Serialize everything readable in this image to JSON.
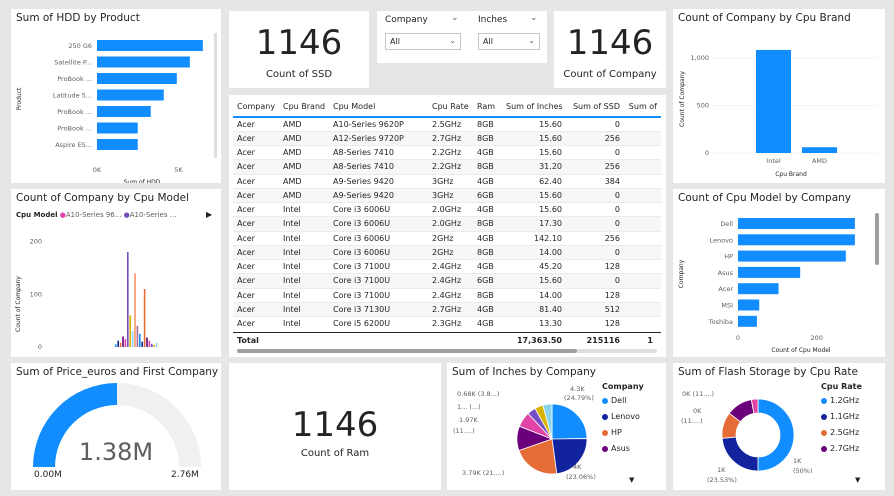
{
  "colors": {
    "accent": "#118dff",
    "dark": "#12239e",
    "orange": "#e66c37",
    "purple": "#6b007b",
    "pink": "#e044a7",
    "violet": "#744ec2",
    "yellow": "#d9b300",
    "track": "#f0f0f0"
  },
  "hdd_chart": {
    "title": "Sum of HDD by Product",
    "ylabel": "Product",
    "xlabel": "Sum of HDD",
    "ticks": [
      "0K",
      "5K"
    ],
    "chart_data": {
      "type": "bar",
      "categories": [
        "250 G6",
        "Satellite P...",
        "ProBook ...",
        "Latitude 5...",
        "ProBook ...",
        "ProBook ...",
        "Aspire ES..."
      ],
      "values": [
        6500,
        5700,
        4900,
        4100,
        3300,
        2500,
        2500
      ],
      "xlim": [
        0,
        7000
      ]
    }
  },
  "kpi_ssd": {
    "value": "1146",
    "label": "Count of SSD"
  },
  "slicer_company": {
    "title": "Company",
    "value": "All"
  },
  "slicer_inches": {
    "title": "Inches",
    "value": "All"
  },
  "kpi_company": {
    "value": "1146",
    "label": "Count of Company"
  },
  "cpu_brand_chart": {
    "title": "Count of Company by Cpu Brand",
    "ylabel": "Count of Company",
    "xlabel": "Cpu Brand",
    "yticks": [
      "1,000",
      "500",
      "0"
    ],
    "chart_data": {
      "type": "bar",
      "categories": [
        "Intel",
        "AMD"
      ],
      "values": [
        1085,
        61
      ],
      "ylim": [
        0,
        1200
      ]
    }
  },
  "table": {
    "columns": [
      "Company",
      "Cpu Brand",
      "Cpu Model",
      "Cpu Rate",
      "Ram",
      "Sum of Inches",
      "Sum of SSD",
      "Sum of"
    ],
    "rows": [
      [
        "Acer",
        "AMD",
        "A10-Series 9620P",
        "2.5GHz",
        "8GB",
        "15.60",
        "0",
        ""
      ],
      [
        "Acer",
        "AMD",
        "A12-Series 9720P",
        "2.7GHz",
        "8GB",
        "15.60",
        "256",
        ""
      ],
      [
        "Acer",
        "AMD",
        "A8-Series 7410",
        "2.2GHz",
        "4GB",
        "15.60",
        "0",
        ""
      ],
      [
        "Acer",
        "AMD",
        "A8-Series 7410",
        "2.2GHz",
        "8GB",
        "31.20",
        "256",
        ""
      ],
      [
        "Acer",
        "AMD",
        "A9-Series 9420",
        "3GHz",
        "4GB",
        "62.40",
        "384",
        ""
      ],
      [
        "Acer",
        "AMD",
        "A9-Series 9420",
        "3GHz",
        "6GB",
        "15.60",
        "0",
        ""
      ],
      [
        "Acer",
        "Intel",
        "Core i3 6006U",
        "2.0GHz",
        "4GB",
        "15.60",
        "0",
        ""
      ],
      [
        "Acer",
        "Intel",
        "Core i3 6006U",
        "2.0GHz",
        "8GB",
        "17.30",
        "0",
        ""
      ],
      [
        "Acer",
        "Intel",
        "Core i3 6006U",
        "2GHz",
        "4GB",
        "142.10",
        "256",
        ""
      ],
      [
        "Acer",
        "Intel",
        "Core i3 6006U",
        "2GHz",
        "8GB",
        "14.00",
        "0",
        ""
      ],
      [
        "Acer",
        "Intel",
        "Core i3 7100U",
        "2.4GHz",
        "4GB",
        "45.20",
        "128",
        ""
      ],
      [
        "Acer",
        "Intel",
        "Core i3 7100U",
        "2.4GHz",
        "6GB",
        "15.60",
        "0",
        ""
      ],
      [
        "Acer",
        "Intel",
        "Core i3 7100U",
        "2.4GHz",
        "8GB",
        "14.00",
        "128",
        ""
      ],
      [
        "Acer",
        "Intel",
        "Core i3 7130U",
        "2.7GHz",
        "4GB",
        "81.40",
        "512",
        ""
      ],
      [
        "Acer",
        "Intel",
        "Core i5 6200U",
        "2.3GHz",
        "4GB",
        "13.30",
        "128",
        ""
      ]
    ],
    "total": {
      "label": "Total",
      "inches": "17,363.50",
      "ssd": "215116",
      "more": "1"
    }
  },
  "cpu_model_chart": {
    "title": "Count of Company by Cpu Model",
    "legend_label": "Cpu Model",
    "legend_items": [
      "A10-Series 96...",
      "A10-Series ..."
    ],
    "ylabel": "Count of Company",
    "yticks": [
      "200",
      "100",
      "0"
    ],
    "chart_data": {
      "type": "bar",
      "note": "clustered bars by Cpu Model",
      "values": [
        5,
        12,
        8,
        20,
        15,
        180,
        60,
        30,
        140,
        40,
        25,
        10,
        110,
        18,
        12,
        6,
        4,
        8
      ],
      "ylim": [
        0,
        220
      ]
    }
  },
  "cpu_model_company_chart": {
    "title": "Count of Cpu Model by Company",
    "ylabel": "Company",
    "xlabel": "Count of Cpu Model",
    "ticks": [
      "0",
      "200"
    ],
    "chart_data": {
      "type": "bar",
      "categories": [
        "Dell",
        "Lenovo",
        "HP",
        "Asus",
        "Acer",
        "MSI",
        "Toshiba"
      ],
      "values": [
        297,
        297,
        274,
        158,
        103,
        54,
        48
      ],
      "xlim": [
        0,
        310
      ]
    }
  },
  "gauge": {
    "title": "Sum of Price_euros and First Company",
    "value": "1.38M",
    "min": "0.00M",
    "max": "2.76M",
    "fraction": 0.5
  },
  "kpi_ram": {
    "value": "1146",
    "label": "Count of Ram"
  },
  "inches_pie": {
    "title": "Sum of Inches by Company",
    "legend_title": "Company",
    "legend": [
      {
        "name": "Dell",
        "color": "#118dff"
      },
      {
        "name": "Lenovo",
        "color": "#12239e"
      },
      {
        "name": "HP",
        "color": "#e66c37"
      },
      {
        "name": "Asus",
        "color": "#6b007b"
      }
    ],
    "labels": [
      "4.3K",
      "(24.79%)",
      "4K",
      "(23.06%)",
      "3.79K (21....)",
      "1.97K",
      "(11....)",
      "1... (...)",
      "0.68K (3.8...)"
    ],
    "chart_data": {
      "type": "pie",
      "categories": [
        "Dell",
        "Lenovo",
        "HP",
        "Asus",
        "Acer",
        "MSI",
        "Toshiba",
        "Other"
      ],
      "values": [
        24.79,
        23.06,
        21.8,
        11.3,
        7.0,
        4.0,
        3.85,
        4.2
      ]
    }
  },
  "flash_donut": {
    "title": "Sum of Flash Storage by Cpu Rate",
    "legend_title": "Cpu Rate",
    "legend": [
      {
        "name": "1.2GHz",
        "color": "#118dff"
      },
      {
        "name": "1.1GHz",
        "color": "#12239e"
      },
      {
        "name": "2.5GHz",
        "color": "#e66c37"
      },
      {
        "name": "2.7GHz",
        "color": "#6b007b"
      }
    ],
    "labels": [
      "0K (11....)",
      "0K",
      "(11....)",
      "1K",
      "(23.53%)",
      "1K",
      "(50%)"
    ],
    "chart_data": {
      "type": "pie",
      "categories": [
        "1.2GHz",
        "1.1GHz",
        "2.5GHz",
        "2.7GHz",
        "Other"
      ],
      "values": [
        50,
        23.53,
        11.76,
        11.76,
        2.95
      ]
    }
  }
}
